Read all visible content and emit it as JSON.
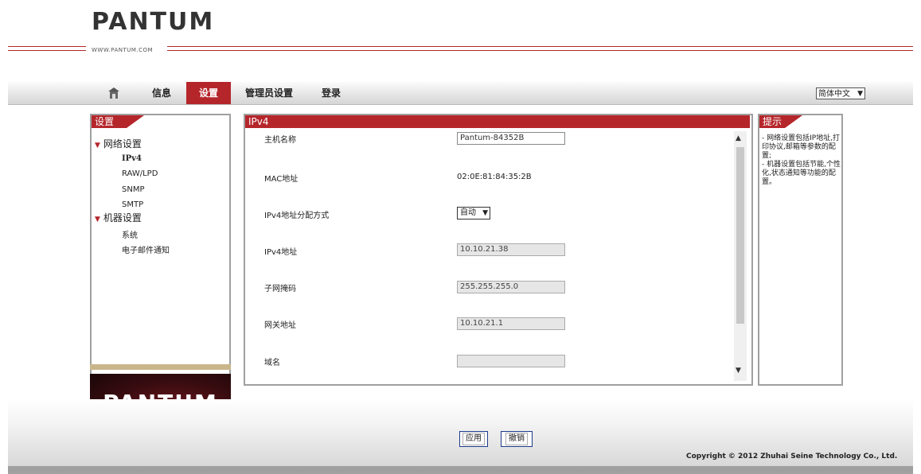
{
  "header": {
    "logo": "PANTUM",
    "url": "WWW.PANTUM.COM"
  },
  "nav": {
    "home_icon": "home-icon",
    "info": "信息",
    "settings": "设置",
    "admin_settings": "管理员设置",
    "login": "登录",
    "language": "简体中文",
    "active_color": "#b5262b"
  },
  "sidebar": {
    "title": "设置",
    "network_group": "网络设置",
    "network_items": [
      "IPv4",
      "RAW/LPD",
      "SNMP",
      "SMTP"
    ],
    "machine_group": "机器设置",
    "machine_items": [
      "系统",
      "电子邮件通知"
    ],
    "brand_logo": "PANTUM"
  },
  "main": {
    "title": "IPv4",
    "fields": {
      "hostname_label": "主机名称",
      "hostname_value": "Pantum-84352B",
      "mac_label": "MAC地址",
      "mac_value": "02:0E:81:84:35:2B",
      "ip_mode_label": "IPv4地址分配方式",
      "ip_mode_value": "自动",
      "ipv4_label": "IPv4地址",
      "ipv4_value": "10.10.21.38",
      "subnet_label": "子网掩码",
      "subnet_value": "255.255.255.0",
      "gateway_label": "网关地址",
      "gateway_value": "10.10.21.1",
      "domain_label": "域名",
      "domain_value": ""
    }
  },
  "hint": {
    "title": "提示",
    "text": "- 网络设置包括IP地址,打印协议,邮箱等参数的配置;\n- 机器设置包括节能,个性化,状态通知等功能的配置。"
  },
  "footer": {
    "apply": "应用",
    "cancel": "撤销",
    "copyright": "Copyright © 2012 Zhuhai Seine Technology Co., Ltd."
  }
}
